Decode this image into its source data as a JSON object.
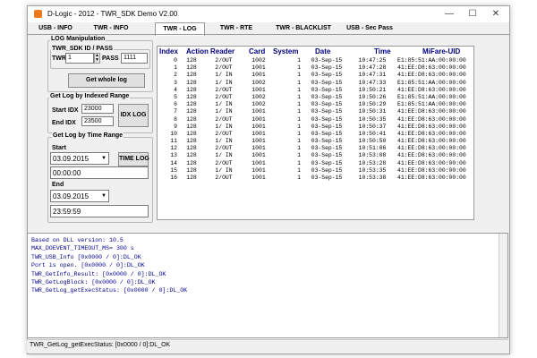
{
  "window": {
    "title": "D-Logic - 2012 - TWR_SDK Demo V2.00",
    "minimize": "—",
    "maximize": "☐",
    "close": "✕"
  },
  "tabs": [
    "USB - INFO",
    "TWR - INFO",
    "TWR - LOG",
    "TWR - RTE",
    "TWR - BLACKLIST",
    "USB - Sec Pass"
  ],
  "active_tab": "TWR - LOG",
  "log_manipulation": {
    "group_label": "LOG Manipulation",
    "sdk_label": "TWR_SDK ID / PASS",
    "twr_label": "TWR",
    "twr_value": "1",
    "pass_label": "PASS",
    "pass_value": "1111",
    "get_whole_log": "Get whole log"
  },
  "indexed_range": {
    "group_label": "Get Log by Indexed Range",
    "start_label": "Start IDX",
    "start_value": "23000",
    "end_label": "End IDX",
    "end_value": "23500",
    "button": "IDX LOG"
  },
  "time_range": {
    "group_label": "Get Log by Time Range",
    "start_label": "Start",
    "start_date": "03.09.2015",
    "start_time": "00:00:00",
    "end_label": "End",
    "end_date": "03.09.2015",
    "end_time": "23:59:59",
    "button": "TIME LOG"
  },
  "table": {
    "headers": [
      "Index",
      "Action",
      "Reader",
      "Card",
      "System",
      "Date",
      "Time",
      "MiFare-UID"
    ],
    "rows": [
      [
        "0",
        "128",
        "2/OUT",
        "1002",
        "1",
        "03-Sep-15",
        "10:47:25",
        "E1:85:51:AA:00:00:00"
      ],
      [
        "1",
        "128",
        "2/OUT",
        "1001",
        "1",
        "03-Sep-15",
        "10:47:28",
        "41:EE:D8:63:00:00:00"
      ],
      [
        "2",
        "128",
        "1/ IN",
        "1001",
        "1",
        "03-Sep-15",
        "10:47:31",
        "41:EE:D8:63:00:00:00"
      ],
      [
        "3",
        "128",
        "1/ IN",
        "1002",
        "1",
        "03-Sep-15",
        "10:47:33",
        "E1:85:51:AA:00:00:00"
      ],
      [
        "4",
        "128",
        "2/OUT",
        "1001",
        "1",
        "03-Sep-15",
        "10:50:21",
        "41:EE:D8:63:00:00:00"
      ],
      [
        "5",
        "128",
        "2/OUT",
        "1002",
        "1",
        "03-Sep-15",
        "10:50:26",
        "E1:85:51:AA:00:00:00"
      ],
      [
        "6",
        "128",
        "1/ IN",
        "1002",
        "1",
        "03-Sep-15",
        "10:50:29",
        "E1:85:51:AA:00:00:00"
      ],
      [
        "7",
        "128",
        "1/ IN",
        "1001",
        "1",
        "03-Sep-15",
        "10:50:31",
        "41:EE:D8:63:00:00:00"
      ],
      [
        "8",
        "128",
        "2/OUT",
        "1001",
        "1",
        "03-Sep-15",
        "10:50:35",
        "41:EE:D8:63:00:00:00"
      ],
      [
        "9",
        "128",
        "1/ IN",
        "1001",
        "1",
        "03-Sep-15",
        "10:50:37",
        "41:EE:D8:63:00:00:00"
      ],
      [
        "10",
        "128",
        "2/OUT",
        "1001",
        "1",
        "03-Sep-15",
        "10:50:41",
        "41:EE:D8:63:00:00:00"
      ],
      [
        "11",
        "128",
        "1/ IN",
        "1001",
        "1",
        "03-Sep-15",
        "10:50:50",
        "41:EE:D8:63:00:00:00"
      ],
      [
        "12",
        "128",
        "2/OUT",
        "1001",
        "1",
        "03-Sep-15",
        "10:51:06",
        "41:EE:D8:63:00:00:00"
      ],
      [
        "13",
        "128",
        "1/ IN",
        "1001",
        "1",
        "03-Sep-15",
        "10:53:08",
        "41:EE:D8:63:00:00:00"
      ],
      [
        "14",
        "128",
        "2/OUT",
        "1001",
        "1",
        "03-Sep-15",
        "10:53:28",
        "41:EE:D8:63:00:00:00"
      ],
      [
        "15",
        "128",
        "1/ IN",
        "1001",
        "1",
        "03-Sep-15",
        "10:53:35",
        "41:EE:D8:63:00:00:00"
      ],
      [
        "16",
        "128",
        "2/OUT",
        "1001",
        "1",
        "03-Sep-15",
        "10:53:38",
        "41:EE:D8:63:00:00:00"
      ]
    ]
  },
  "log_lines": [
    "Based on DLL version: 10.5",
    "MAX_DOEVENT_TIMEOUT_MS= 300 s",
    "TWR_USB_Info [0x0000 / 0]:DL_OK",
    "Port is open. [0x0000 / 0]:DL_OK",
    "TWR_GetInfo_Result: [0x0000 / 0]:DL_OK",
    "TWR_GetLogBlock: [0x0000 / 0]:DL_OK",
    "TWR_GetLog_getExecStatus: [0x0000 / 0]:DL_OK"
  ],
  "status_bar": "TWR_GetLog_getExecStatus: [0x0000 / 0]:DL_OK",
  "colors": {
    "accent": "#f07a1a",
    "header_text": "#00007f",
    "log_text": "#00008b"
  }
}
